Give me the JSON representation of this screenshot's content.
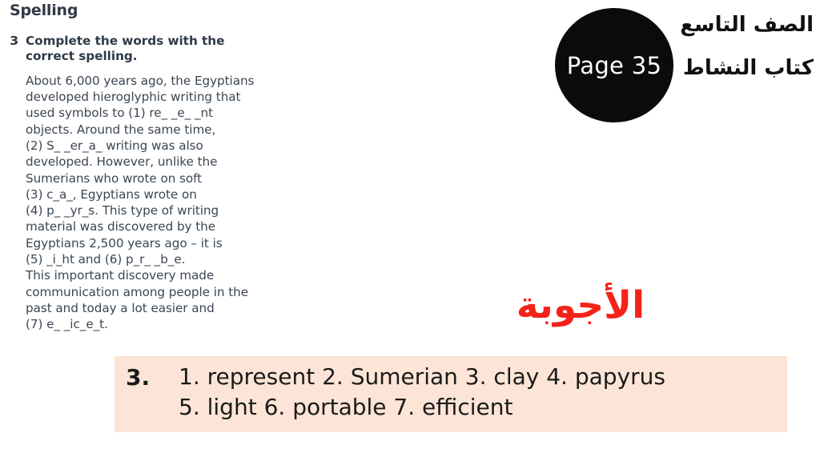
{
  "worksheet": {
    "section_heading": "Spelling",
    "exercise_number": "3",
    "exercise_prompt": "Complete the words with the correct spelling.",
    "passage": "About 6,000 years ago, the Egyptians\ndeveloped hieroglyphic writing that\nused symbols to (1) re_ _e_ _nt\nobjects. Around the same time,\n(2) S_ _er_a_ writing was also\ndeveloped. However, unlike the\nSumerians who wrote on soft\n(3) c_a_, Egyptians wrote on\n(4) p_ _yr_s. This type of writing\nmaterial was discovered by the\nEgyptians 2,500 years ago – it is\n(5) _i_ht and (6) p_r_ _b_e.\nThis important discovery made\ncommunication among people in the\npast and today a lot easier and\n(7) e_ _ic_e_t."
  },
  "page_badge": {
    "label": "Page 35",
    "background_color": "#0b0b0b",
    "text_color": "#ffffff"
  },
  "arabic_header": {
    "grade_line": "الصف التاسع",
    "book_line": "كتاب النشاط",
    "text_color": "#111111"
  },
  "answers_title": {
    "text": "الأجوبة",
    "color": "#f4231a"
  },
  "answer_panel": {
    "background_color": "#fce5d6",
    "exercise_number": "3.",
    "line1": [
      {
        "num": "1.",
        "word": "represent"
      },
      {
        "num": "2.",
        "word": "Sumerian"
      },
      {
        "num": "3.",
        "word": "clay"
      },
      {
        "num": "4.",
        "word": "papyrus"
      }
    ],
    "line2": [
      {
        "num": "5.",
        "word": "light"
      },
      {
        "num": "6.",
        "word": "portable"
      },
      {
        "num": "7.",
        "word": "efficient"
      }
    ],
    "line1_text": "1. represent  2. Sumerian  3. clay  4. papyrus",
    "line2_text": "5. light  6. portable  7. efficient"
  }
}
